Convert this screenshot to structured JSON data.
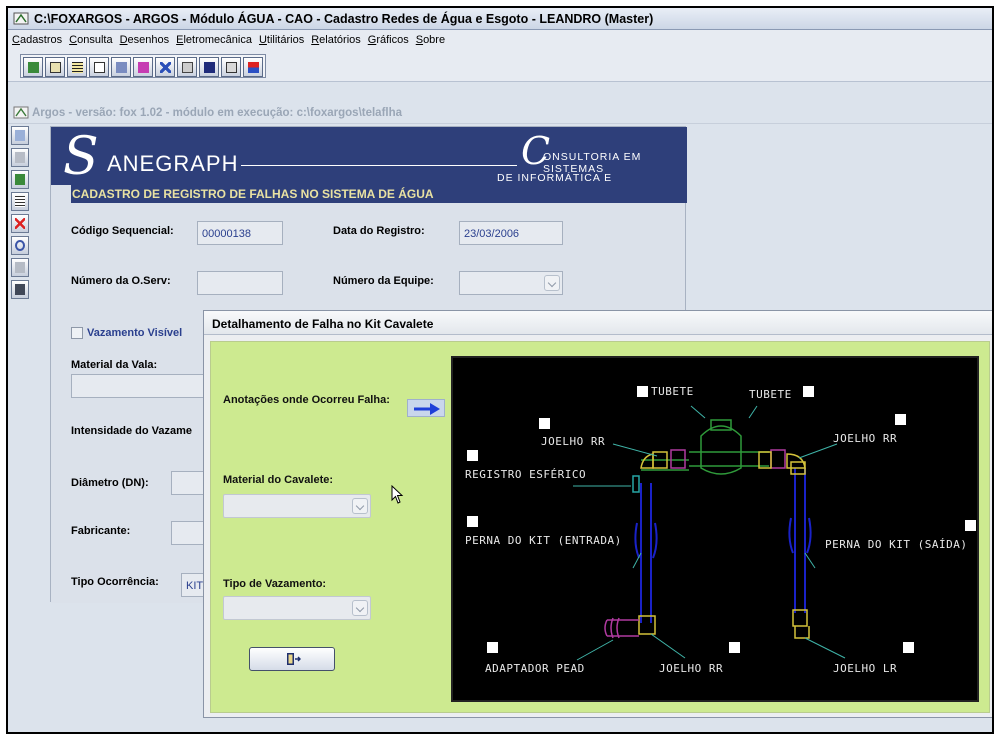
{
  "window": {
    "title": "C:\\FOXARGOS - ARGOS - Módulo ÁGUA - CAO - Cadastro Redes de Água e Esgoto - LEANDRO (Master)"
  },
  "menu": [
    "Cadastros",
    "Consulta",
    "Desenhos",
    "Eletromecânica",
    "Utilitários",
    "Relatórios",
    "Gráficos",
    "Sobre"
  ],
  "status_line": "Argos - versão: fox 1.02 - módulo em execução: c:\\foxargos\\telaflha",
  "banner": {
    "brand": "ANEGRAPH",
    "brand_initial": "S",
    "consult_initial": "C",
    "consult_line1": "ONSULTORIA EM SISTEMAS",
    "consult_line2": "DE INFORMÁTICA E SANEAMENTO"
  },
  "form": {
    "title": "CADASTRO DE REGISTRO DE FALHAS NO SISTEMA DE ÁGUA",
    "codigo_label": "Código Sequencial:",
    "codigo_value": "00000138",
    "data_label": "Data do Registro:",
    "data_value": "23/03/2006",
    "numero_os_label": "Número da O.Serv:",
    "numero_equipe_label": "Número da Equipe:",
    "vazamento_visivel_label": "Vazamento Visível",
    "material_vala_label": "Material da Vala:",
    "intensidade_label": "Intensidade do Vazame",
    "diametro_label": "Diâmetro (DN):",
    "fabricante_label": "Fabricante:",
    "tipo_ocorrencia_label": "Tipo Ocorrência:",
    "tipo_ocorrencia_value": "KIT"
  },
  "dialog": {
    "title": "Detalhamento de Falha no Kit Cavalete",
    "anotacoes_label": "Anotações onde Ocorreu Falha:",
    "material_cavalete_label": "Material do Cavalete:",
    "tipo_vazamento_label": "Tipo de Vazamento:"
  },
  "diagram": {
    "labels": {
      "tubete_left": "TUBETE",
      "tubete_right": "TUBETE",
      "joelho_rr_upper_left": "JOELHO RR",
      "joelho_rr_upper_right": "JOELHO RR",
      "registro_esferico": "REGISTRO ESFÉRICO",
      "perna_entrada": "PERNA DO KIT (ENTRADA)",
      "perna_saida": "PERNA DO KIT (SAÍDA)",
      "adaptador_pead": "ADAPTADOR PEAD",
      "joelho_rr_lower": "JOELHO RR",
      "joelho_lr": "JOELHO LR"
    },
    "colors": {
      "pipe": "#1a22c8",
      "meter": "#2f9a3a",
      "fitting": "#d4c23a",
      "tubete": "#b03aa0",
      "registro": "#27a6a6",
      "leader": "#3fb4a8"
    }
  },
  "icons": {
    "toolbar": [
      "exit-icon",
      "form-icon",
      "table-icon",
      "report-icon",
      "tools-icon",
      "print-icon",
      "network-icon",
      "copy-icon",
      "save-icon",
      "window-icon",
      "sort-icon"
    ],
    "sidebar": [
      "new-icon",
      "save-icon",
      "exit-icon",
      "list-icon",
      "delete-icon",
      "undo-icon",
      "edit-icon",
      "print-icon"
    ]
  }
}
